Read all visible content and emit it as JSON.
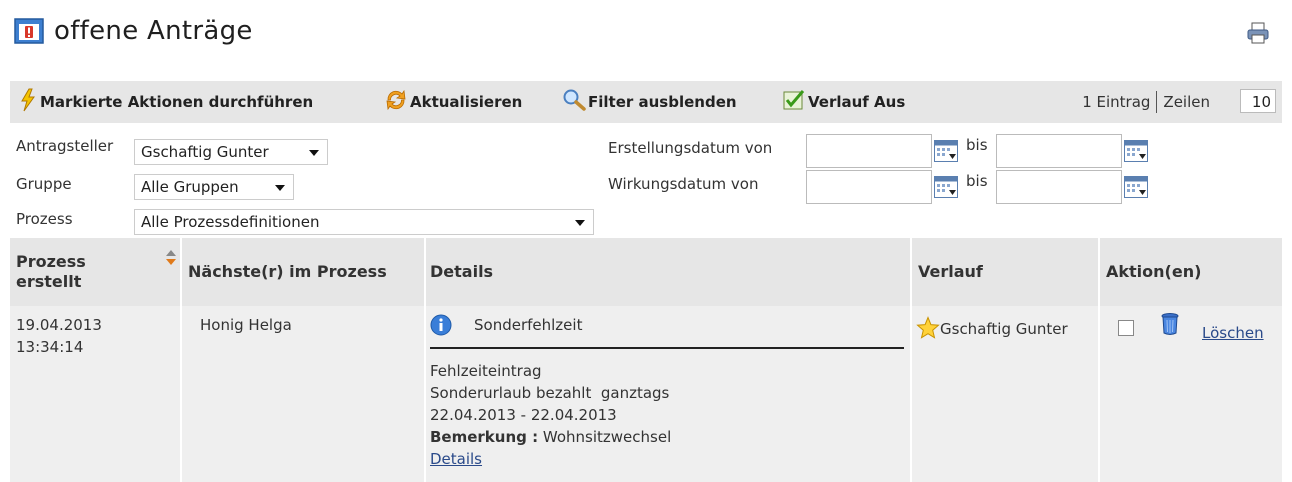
{
  "header": {
    "title": "offene Anträge",
    "title_icon": "warning-doc-icon",
    "print_icon": "print-icon"
  },
  "toolbar": {
    "actions_label": "Markierte Aktionen durchführen",
    "refresh_label": "Aktualisieren",
    "filter_label": "Filter ausblenden",
    "history_label": "Verlauf Aus",
    "entry_count": "1 Eintrag",
    "rows_label": "Zeilen",
    "rows_value": "10"
  },
  "filters": {
    "applicant_label": "Antragsteller",
    "applicant_value": "Gschaftig Gunter",
    "group_label": "Gruppe",
    "group_value": "Alle Gruppen",
    "process_label": "Prozess",
    "process_value": "Alle Prozessdefinitionen",
    "created_label": "Erstellungsdatum von",
    "effective_label": "Wirkungsdatum von",
    "to_label": "bis"
  },
  "table": {
    "headers": {
      "created_line1": "Prozess",
      "created_line2": "erstellt",
      "next": "Nächste(r) im Prozess",
      "details": "Details",
      "history": "Verlauf",
      "actions": "Aktion(en)"
    },
    "rows": [
      {
        "date": "19.04.2013",
        "time": "13:34:14",
        "next": "Honig Helga",
        "detail_title": "Sonderfehlzeit",
        "detail_line1": "Fehlzeiteintrag",
        "detail_line2": "Sonderurlaub bezahlt  ganztags",
        "detail_line3": "22.04.2013 - 22.04.2013",
        "remark_label": "Bemerkung :",
        "remark_value": "Wohnsitzwechsel",
        "details_link": "Details",
        "history_person": "Gschaftig Gunter",
        "delete_link": "Löschen"
      }
    ]
  },
  "colors": {
    "toolbar_bg": "#e6e6e6",
    "row_bg": "#efefef",
    "link": "#2a4a8a",
    "accent_orange": "#e07a1a"
  }
}
